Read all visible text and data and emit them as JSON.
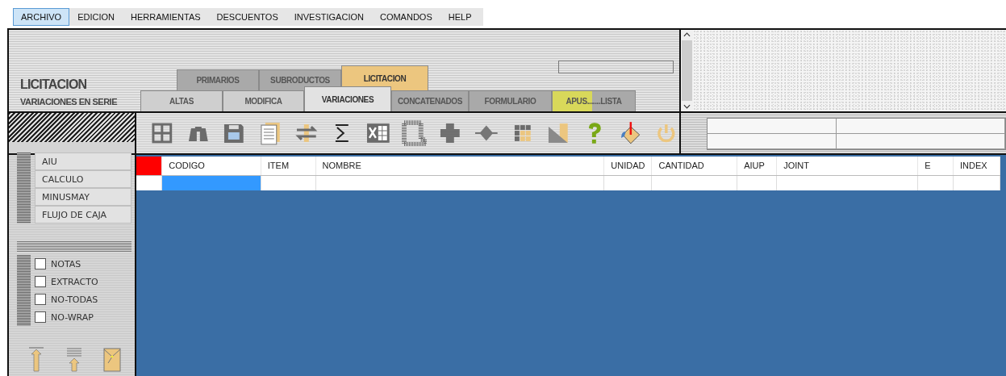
{
  "menu": [
    {
      "label": "ARCHIVO",
      "selected": true
    },
    {
      "label": "EDICION",
      "selected": false
    },
    {
      "label": "HERRAMIENTAS",
      "selected": false
    },
    {
      "label": "DESCUENTOS",
      "selected": false
    },
    {
      "label": "INVESTIGACION",
      "selected": false
    },
    {
      "label": "COMANDOS",
      "selected": false
    },
    {
      "label": "HELP",
      "selected": false
    }
  ],
  "title": "LICITACION",
  "subtitle": "VARIACIONES EN SERIE",
  "tabs_top": [
    {
      "label": "PRIMARIOS",
      "selected": false,
      "color": "#a9a9a9"
    },
    {
      "label": "SUBRODUCTOS",
      "selected": false,
      "color": "#a9a9a9"
    },
    {
      "label": "LICITACION",
      "selected": true,
      "color": "#ecc67f"
    }
  ],
  "tabs_bottom": [
    {
      "label": "ALTAS",
      "selected": false,
      "color": "#cfcfcf"
    },
    {
      "label": "MODIFICA",
      "selected": false,
      "color": "#cfcfcf"
    },
    {
      "label": "VARIACIONES",
      "selected": true,
      "color": "#e2e2e2"
    },
    {
      "label": "CONCATENADOS",
      "selected": false,
      "color": "#a9a9a9"
    },
    {
      "label": "FORMULARIO",
      "selected": false,
      "color": "#a9a9a9"
    },
    {
      "label": "APUS.......LISTA",
      "selected": false,
      "color": "#d8d85a"
    }
  ],
  "side_buttons": [
    "AIU",
    "CALCULO",
    "MINUSMAY",
    "FLUJO DE CAJA"
  ],
  "options": [
    {
      "label": "NOTAS",
      "checked": false
    },
    {
      "label": "EXTRACTO",
      "checked": false
    },
    {
      "label": "NO-TODAS",
      "checked": false
    },
    {
      "label": "NO-WRAP",
      "checked": false
    }
  ],
  "table": {
    "columns": [
      "CODIGO",
      "ITEM",
      "NOMBRE",
      "UNIDAD",
      "CANTIDAD",
      "AIUP",
      "JOINT",
      "E",
      "INDEX"
    ],
    "rows": [
      {
        "cells": [
          {
            "selected": true
          },
          {
            "selected": false
          },
          {
            "selected": false
          },
          {
            "selected": false
          },
          {
            "selected": false
          },
          {
            "selected": false
          },
          {
            "selected": false
          },
          {
            "selected": false
          },
          {
            "selected": false
          }
        ]
      }
    ]
  }
}
